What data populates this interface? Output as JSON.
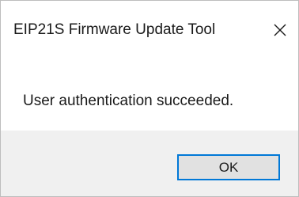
{
  "dialog": {
    "title": "EIP21S Firmware Update Tool",
    "close_icon": "close-icon",
    "message": "User authentication succeeded.",
    "ok_label": "OK"
  },
  "colors": {
    "footer_background": "#f0f0f0",
    "button_face": "#e1e1e1",
    "button_focus_border": "#0078d7"
  }
}
